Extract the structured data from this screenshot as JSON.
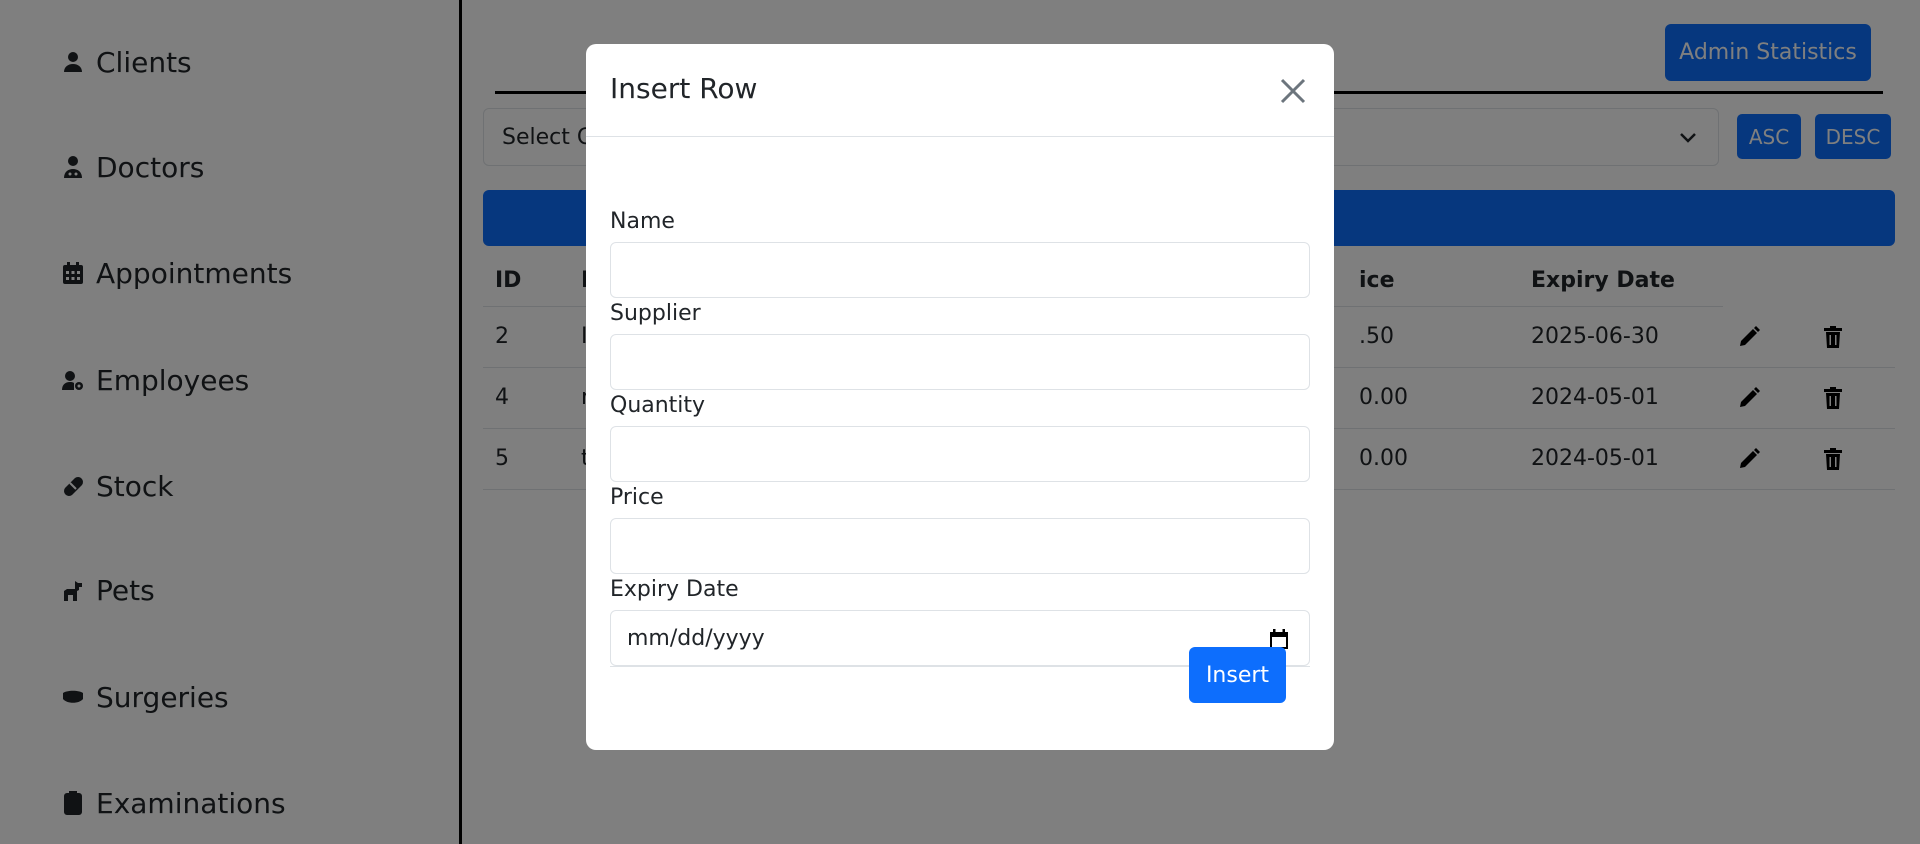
{
  "sidebar": {
    "items": [
      {
        "label": "Clients",
        "icon": "person-icon"
      },
      {
        "label": "Doctors",
        "icon": "doctor-icon"
      },
      {
        "label": "Appointments",
        "icon": "calendar-icon"
      },
      {
        "label": "Employees",
        "icon": "user-gear-icon"
      },
      {
        "label": "Stock",
        "icon": "pill-icon"
      },
      {
        "label": "Pets",
        "icon": "dog-icon"
      },
      {
        "label": "Surgeries",
        "icon": "mask-icon"
      },
      {
        "label": "Examinations",
        "icon": "clipboard-pulse-icon"
      }
    ]
  },
  "header": {
    "admin_button": "Admin Statistics"
  },
  "filter": {
    "select_value": "Select C",
    "asc": "ASC",
    "desc": "DESC"
  },
  "table": {
    "headers": [
      "ID",
      "N",
      "ice",
      "Expiry Date"
    ],
    "rows": [
      {
        "id": "2",
        "name": "I",
        "price": ".50",
        "expiry": "2025-06-30"
      },
      {
        "id": "4",
        "name": "r",
        "price": "0.00",
        "expiry": "2024-05-01"
      },
      {
        "id": "5",
        "name": "t",
        "price": "0.00",
        "expiry": "2024-05-01"
      }
    ]
  },
  "modal": {
    "title": "Insert Row",
    "fields": [
      {
        "label": "Name",
        "value": ""
      },
      {
        "label": "Supplier",
        "value": ""
      },
      {
        "label": "Quantity",
        "value": ""
      },
      {
        "label": "Price",
        "value": ""
      },
      {
        "label": "Expiry Date",
        "value": "mm/dd/yyyy"
      }
    ],
    "insert_button": "Insert"
  },
  "colors": {
    "primary": "#0d6efd",
    "backdrop": "rgba(0,0,0,0.5)"
  }
}
